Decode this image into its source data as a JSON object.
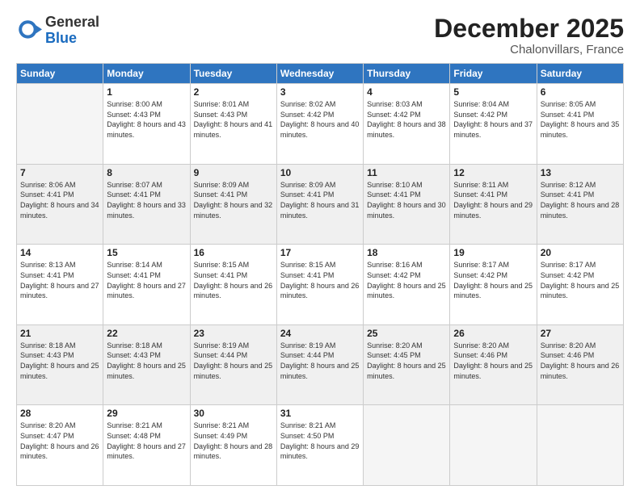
{
  "logo": {
    "general": "General",
    "blue": "Blue"
  },
  "title": "December 2025",
  "location": "Chalonvillars, France",
  "days_header": [
    "Sunday",
    "Monday",
    "Tuesday",
    "Wednesday",
    "Thursday",
    "Friday",
    "Saturday"
  ],
  "weeks": [
    {
      "shaded": false,
      "days": [
        {
          "num": "",
          "empty": true
        },
        {
          "num": "1",
          "sunrise": "8:00 AM",
          "sunset": "4:43 PM",
          "daylight": "8 hours and 43 minutes."
        },
        {
          "num": "2",
          "sunrise": "8:01 AM",
          "sunset": "4:43 PM",
          "daylight": "8 hours and 41 minutes."
        },
        {
          "num": "3",
          "sunrise": "8:02 AM",
          "sunset": "4:42 PM",
          "daylight": "8 hours and 40 minutes."
        },
        {
          "num": "4",
          "sunrise": "8:03 AM",
          "sunset": "4:42 PM",
          "daylight": "8 hours and 38 minutes."
        },
        {
          "num": "5",
          "sunrise": "8:04 AM",
          "sunset": "4:42 PM",
          "daylight": "8 hours and 37 minutes."
        },
        {
          "num": "6",
          "sunrise": "8:05 AM",
          "sunset": "4:41 PM",
          "daylight": "8 hours and 35 minutes."
        }
      ]
    },
    {
      "shaded": true,
      "days": [
        {
          "num": "7",
          "sunrise": "8:06 AM",
          "sunset": "4:41 PM",
          "daylight": "8 hours and 34 minutes."
        },
        {
          "num": "8",
          "sunrise": "8:07 AM",
          "sunset": "4:41 PM",
          "daylight": "8 hours and 33 minutes."
        },
        {
          "num": "9",
          "sunrise": "8:09 AM",
          "sunset": "4:41 PM",
          "daylight": "8 hours and 32 minutes."
        },
        {
          "num": "10",
          "sunrise": "8:09 AM",
          "sunset": "4:41 PM",
          "daylight": "8 hours and 31 minutes."
        },
        {
          "num": "11",
          "sunrise": "8:10 AM",
          "sunset": "4:41 PM",
          "daylight": "8 hours and 30 minutes."
        },
        {
          "num": "12",
          "sunrise": "8:11 AM",
          "sunset": "4:41 PM",
          "daylight": "8 hours and 29 minutes."
        },
        {
          "num": "13",
          "sunrise": "8:12 AM",
          "sunset": "4:41 PM",
          "daylight": "8 hours and 28 minutes."
        }
      ]
    },
    {
      "shaded": false,
      "days": [
        {
          "num": "14",
          "sunrise": "8:13 AM",
          "sunset": "4:41 PM",
          "daylight": "8 hours and 27 minutes."
        },
        {
          "num": "15",
          "sunrise": "8:14 AM",
          "sunset": "4:41 PM",
          "daylight": "8 hours and 27 minutes."
        },
        {
          "num": "16",
          "sunrise": "8:15 AM",
          "sunset": "4:41 PM",
          "daylight": "8 hours and 26 minutes."
        },
        {
          "num": "17",
          "sunrise": "8:15 AM",
          "sunset": "4:41 PM",
          "daylight": "8 hours and 26 minutes."
        },
        {
          "num": "18",
          "sunrise": "8:16 AM",
          "sunset": "4:42 PM",
          "daylight": "8 hours and 25 minutes."
        },
        {
          "num": "19",
          "sunrise": "8:17 AM",
          "sunset": "4:42 PM",
          "daylight": "8 hours and 25 minutes."
        },
        {
          "num": "20",
          "sunrise": "8:17 AM",
          "sunset": "4:42 PM",
          "daylight": "8 hours and 25 minutes."
        }
      ]
    },
    {
      "shaded": true,
      "days": [
        {
          "num": "21",
          "sunrise": "8:18 AM",
          "sunset": "4:43 PM",
          "daylight": "8 hours and 25 minutes."
        },
        {
          "num": "22",
          "sunrise": "8:18 AM",
          "sunset": "4:43 PM",
          "daylight": "8 hours and 25 minutes."
        },
        {
          "num": "23",
          "sunrise": "8:19 AM",
          "sunset": "4:44 PM",
          "daylight": "8 hours and 25 minutes."
        },
        {
          "num": "24",
          "sunrise": "8:19 AM",
          "sunset": "4:44 PM",
          "daylight": "8 hours and 25 minutes."
        },
        {
          "num": "25",
          "sunrise": "8:20 AM",
          "sunset": "4:45 PM",
          "daylight": "8 hours and 25 minutes."
        },
        {
          "num": "26",
          "sunrise": "8:20 AM",
          "sunset": "4:46 PM",
          "daylight": "8 hours and 25 minutes."
        },
        {
          "num": "27",
          "sunrise": "8:20 AM",
          "sunset": "4:46 PM",
          "daylight": "8 hours and 26 minutes."
        }
      ]
    },
    {
      "shaded": false,
      "days": [
        {
          "num": "28",
          "sunrise": "8:20 AM",
          "sunset": "4:47 PM",
          "daylight": "8 hours and 26 minutes."
        },
        {
          "num": "29",
          "sunrise": "8:21 AM",
          "sunset": "4:48 PM",
          "daylight": "8 hours and 27 minutes."
        },
        {
          "num": "30",
          "sunrise": "8:21 AM",
          "sunset": "4:49 PM",
          "daylight": "8 hours and 28 minutes."
        },
        {
          "num": "31",
          "sunrise": "8:21 AM",
          "sunset": "4:50 PM",
          "daylight": "8 hours and 29 minutes."
        },
        {
          "num": "",
          "empty": true
        },
        {
          "num": "",
          "empty": true
        },
        {
          "num": "",
          "empty": true
        }
      ]
    }
  ]
}
